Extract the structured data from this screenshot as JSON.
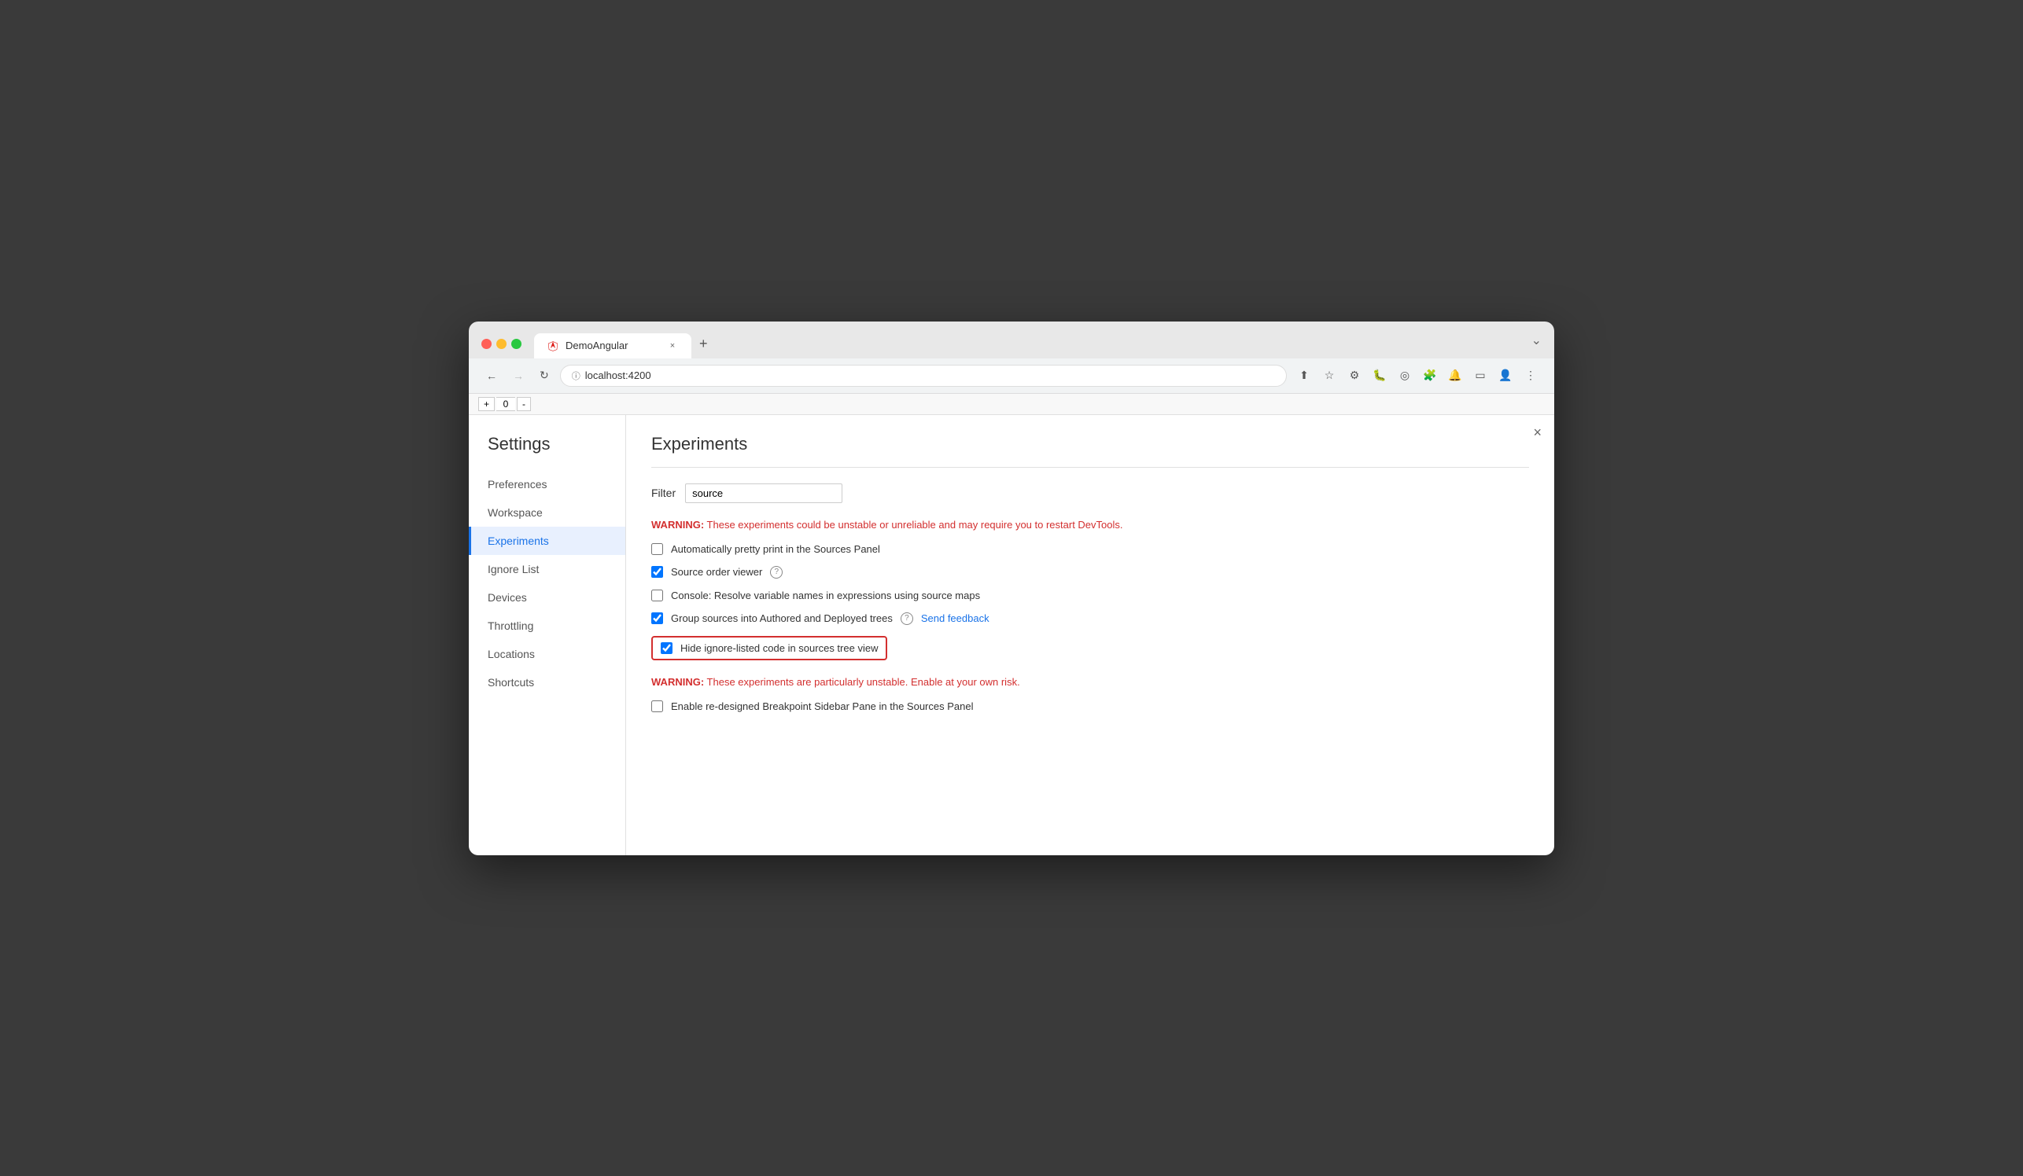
{
  "browser": {
    "tab_title": "DemoAngular",
    "tab_close": "×",
    "tab_new": "+",
    "window_chevron": "⌄",
    "url": "localhost:4200",
    "nav": {
      "back": "←",
      "forward": "→",
      "refresh": "↻"
    }
  },
  "devtools_counter": {
    "add": "+",
    "value": "0",
    "minus": "-"
  },
  "settings": {
    "title": "Settings",
    "close": "×",
    "sidebar_items": [
      {
        "id": "preferences",
        "label": "Preferences",
        "active": false
      },
      {
        "id": "workspace",
        "label": "Workspace",
        "active": false
      },
      {
        "id": "experiments",
        "label": "Experiments",
        "active": true
      },
      {
        "id": "ignore-list",
        "label": "Ignore List",
        "active": false
      },
      {
        "id": "devices",
        "label": "Devices",
        "active": false
      },
      {
        "id": "throttling",
        "label": "Throttling",
        "active": false
      },
      {
        "id": "locations",
        "label": "Locations",
        "active": false
      },
      {
        "id": "shortcuts",
        "label": "Shortcuts",
        "active": false
      }
    ],
    "experiments": {
      "section_title": "Experiments",
      "filter_label": "Filter",
      "filter_value": "source",
      "filter_placeholder": "source",
      "warning1": {
        "prefix": "WARNING:",
        "text": " These experiments could be unstable or unreliable and may require you to restart DevTools."
      },
      "items": [
        {
          "id": "auto-pretty-print",
          "label": "Automatically pretty print in the Sources Panel",
          "checked": false,
          "highlighted": false,
          "has_help": false,
          "has_feedback": false
        },
        {
          "id": "source-order-viewer",
          "label": "Source order viewer",
          "checked": true,
          "highlighted": false,
          "has_help": true,
          "has_feedback": false
        },
        {
          "id": "resolve-variable-names",
          "label": "Console: Resolve variable names in expressions using source maps",
          "checked": false,
          "highlighted": false,
          "has_help": false,
          "has_feedback": false
        },
        {
          "id": "group-sources",
          "label": "Group sources into Authored and Deployed trees",
          "checked": true,
          "highlighted": false,
          "has_help": true,
          "has_feedback": true,
          "feedback_label": "Send feedback"
        },
        {
          "id": "hide-ignore-listed",
          "label": "Hide ignore-listed code in sources tree view",
          "checked": true,
          "highlighted": true,
          "has_help": false,
          "has_feedback": false
        }
      ],
      "warning2": {
        "prefix": "WARNING:",
        "text": " These experiments are particularly unstable. Enable at your own risk."
      },
      "unstable_items": [
        {
          "id": "redesigned-breakpoint",
          "label": "Enable re-designed Breakpoint Sidebar Pane in the Sources Panel",
          "checked": false,
          "highlighted": false,
          "has_help": false,
          "has_feedback": false
        }
      ]
    }
  }
}
